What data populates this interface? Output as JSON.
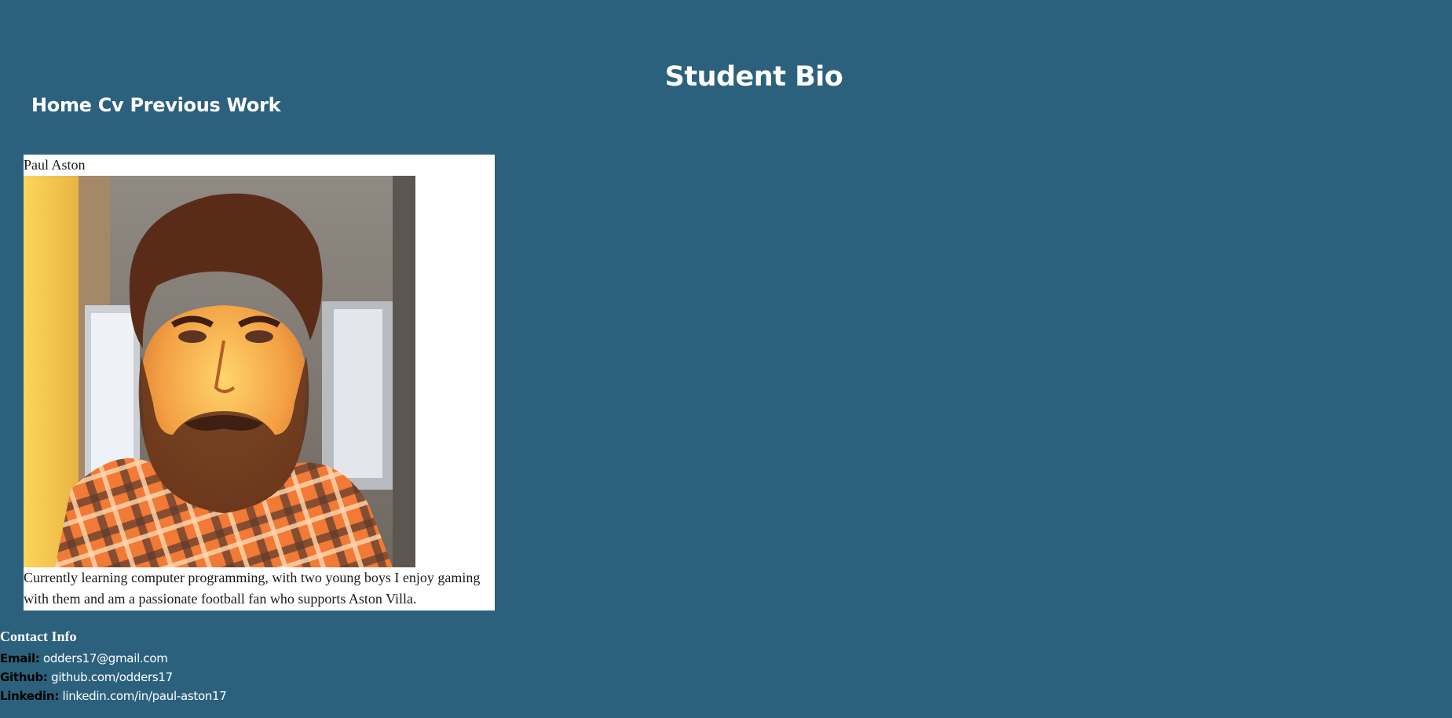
{
  "header": {
    "title": "Student Bio"
  },
  "nav": {
    "items": [
      {
        "label": "Home"
      },
      {
        "label": "Cv"
      },
      {
        "label": "Previous Work"
      }
    ]
  },
  "bio": {
    "name": "Paul Aston",
    "photo_icon": "profile-photo",
    "description": "Currently learning computer programming, with two young boys I enjoy gaming with them and am a passionate football fan who supports Aston Villa."
  },
  "contact": {
    "heading": "Contact Info",
    "email_label": "Email:",
    "email": "odders17@gmail.com",
    "github_label": "Github:",
    "github": "github.com/odders17",
    "linkedin_label": "Linkedin:",
    "linkedin": "linkedin.com/in/paul-aston17"
  },
  "colors": {
    "background": "#2c617e",
    "card": "#ffffff",
    "text_light": "#ffffff",
    "text_dark": "#000000"
  }
}
